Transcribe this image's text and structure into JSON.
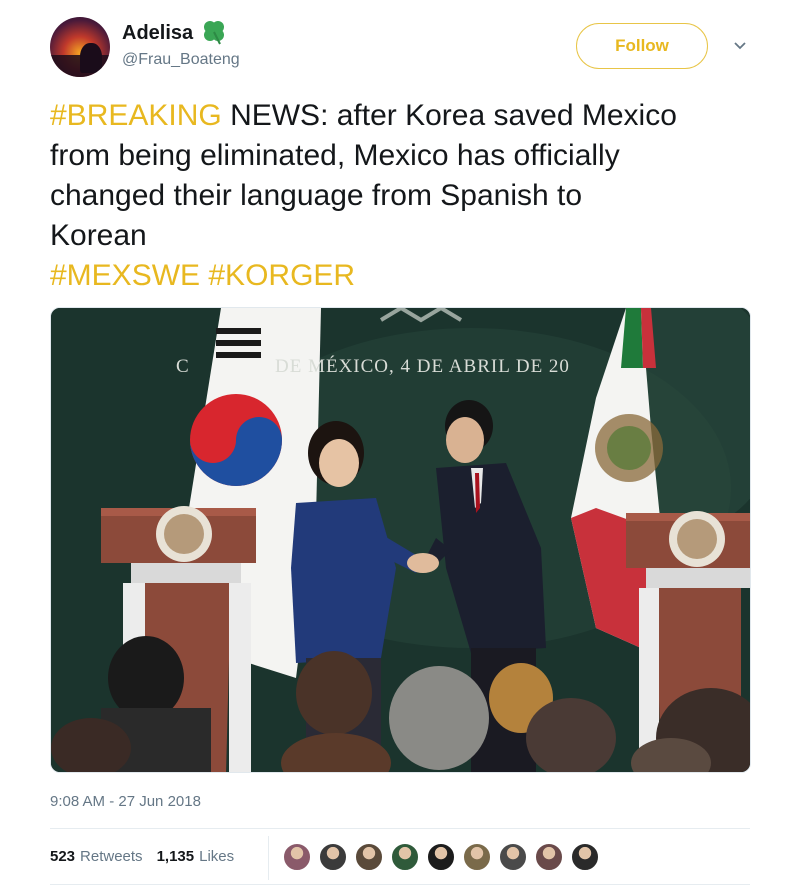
{
  "user": {
    "display_name": "Adelisa",
    "handle": "@Frau_Boateng",
    "badge_icon": "four-leaf-clover-icon"
  },
  "header": {
    "follow_label": "Follow",
    "menu_icon": "chevron-down-icon"
  },
  "tweet": {
    "hashtag_breaking": "#BREAKING",
    "text_line1_rest": " NEWS: after Korea saved Mexico",
    "text_line2": "from being eliminated, Mexico has officially",
    "text_line3": "changed their language from Spanish to",
    "text_line4": "Korean",
    "hashtag_mexswe": "#MEXSWE",
    "hashtag_korger": "#KORGER"
  },
  "media": {
    "banner_first": "C",
    "banner_text": "DE MÉXICO, 4 DE ABRIL DE 20"
  },
  "meta": {
    "timestamp": "9:08 AM - 27 Jun 2018",
    "retweets_count": "523",
    "retweets_label": "Retweets",
    "likes_count": "1,135",
    "likes_label": "Likes"
  },
  "colors": {
    "accent": "#e8b820",
    "secondary_text": "#657786",
    "primary_text": "#14171a"
  },
  "likers": [
    {
      "color": "#8a5a6a"
    },
    {
      "color": "#3b3b3b"
    },
    {
      "color": "#5a4a3a"
    },
    {
      "color": "#2f5a3a"
    },
    {
      "color": "#1c1c1c"
    },
    {
      "color": "#7a6a4a"
    },
    {
      "color": "#4a4a4a"
    },
    {
      "color": "#6a4a4a"
    },
    {
      "color": "#2a2a2a"
    }
  ]
}
